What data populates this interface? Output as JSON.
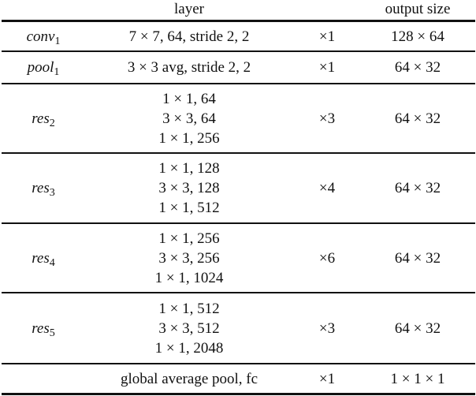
{
  "table": {
    "headers": {
      "name": "",
      "layer": "layer",
      "repeat": "",
      "output": "output size"
    },
    "rows": [
      {
        "name": "conv",
        "sub": "1",
        "layer": [
          "7 × 7, 64, stride 2, 2"
        ],
        "repeat": "×1",
        "output": "128 × 64"
      },
      {
        "name": "pool",
        "sub": "1",
        "layer": [
          "3 × 3 avg, stride 2, 2"
        ],
        "repeat": "×1",
        "output": "64 × 32"
      },
      {
        "name": "res",
        "sub": "2",
        "layer": [
          "1 × 1, 64",
          "3 × 3, 64",
          "1 × 1, 256"
        ],
        "repeat": "×3",
        "output": "64 × 32"
      },
      {
        "name": "res",
        "sub": "3",
        "layer": [
          "1 × 1, 128",
          "3 × 3, 128",
          "1 × 1, 512"
        ],
        "repeat": "×4",
        "output": "64 × 32"
      },
      {
        "name": "res",
        "sub": "4",
        "layer": [
          "1 × 1, 256",
          "3 × 3, 256",
          "1 × 1, 1024"
        ],
        "repeat": "×6",
        "output": "64 × 32"
      },
      {
        "name": "res",
        "sub": "5",
        "layer": [
          "1 × 1, 512",
          "3 × 3, 512",
          "1 × 1, 2048"
        ],
        "repeat": "×3",
        "output": "64 × 32"
      },
      {
        "name": "",
        "sub": "",
        "layer": [
          "global average pool, fc"
        ],
        "repeat": "×1",
        "output": "1 × 1 × 1"
      }
    ]
  }
}
